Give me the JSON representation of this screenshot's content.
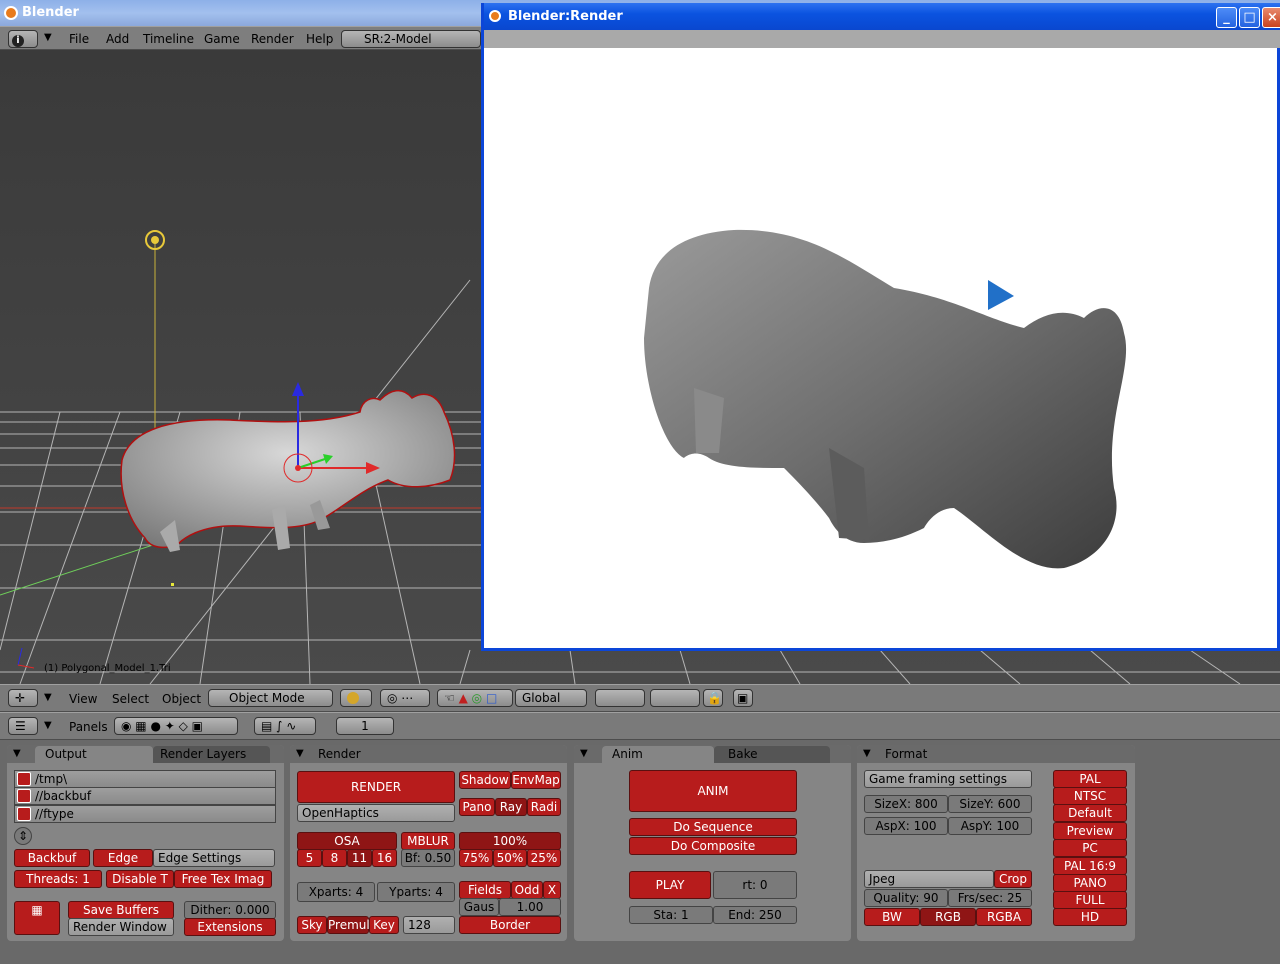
{
  "app": {
    "title": "Blender"
  },
  "menubar": {
    "items": [
      "File",
      "Add",
      "Timeline",
      "Game",
      "Render",
      "Help"
    ],
    "screen": "SR:2-Model"
  },
  "viewport": {
    "object_label": "(1) Polygonal_Model_1.Tri"
  },
  "render_window": {
    "title": "Blender:Render"
  },
  "view3d_header": {
    "menus": [
      "View",
      "Select",
      "Object"
    ],
    "mode": "Object Mode",
    "orientation": "Global"
  },
  "buttons_header": {
    "panels_label": "Panels",
    "frame": "1"
  },
  "output_panel": {
    "tabs": [
      "Output",
      "Render Layers"
    ],
    "paths": [
      "/tmp\\",
      "//backbuf",
      "//ftype"
    ],
    "backbuf": "Backbuf",
    "edge": "Edge",
    "edge_settings": "Edge Settings",
    "threads": "Threads: 1",
    "disable_tex": "Disable T",
    "free_tex": "Free Tex Imag",
    "save_buffers": "Save Buffers",
    "dither": "Dither: 0.000",
    "render_window": "Render Window",
    "extensions": "Extensions"
  },
  "render_panel": {
    "title": "Render",
    "render_btn": "RENDER",
    "renderer": "OpenHaptics",
    "shadow": "Shadow",
    "envmap": "EnvMap",
    "pano": "Pano",
    "ray": "Ray",
    "radi": "Radi",
    "osa": "OSA",
    "osa_values": [
      "5",
      "8",
      "11",
      "16"
    ],
    "mblur": "MBLUR",
    "bf": "Bf: 0.50",
    "percent": "100%",
    "percents": [
      "75%",
      "50%",
      "25%"
    ],
    "xparts": "Xparts: 4",
    "yparts": "Yparts: 4",
    "fields": "Fields",
    "odd": "Odd",
    "x": "X",
    "gaus": "Gaus",
    "gaus_val": "1.00",
    "sky": "Sky",
    "premul": "Premul",
    "key": "Key",
    "bits": "128",
    "border": "Border"
  },
  "anim_panel": {
    "tabs": [
      "Anim",
      "Bake"
    ],
    "anim": "ANIM",
    "do_sequence": "Do Sequence",
    "do_composite": "Do Composite",
    "play": "PLAY",
    "rt": "rt: 0",
    "sta": "Sta: 1",
    "end": "End: 250"
  },
  "format_panel": {
    "title": "Format",
    "preset": "Game framing settings",
    "sizex": "SizeX: 800",
    "sizey": "SizeY: 600",
    "aspx": "AspX: 100",
    "aspy": "AspY: 100",
    "format": "Jpeg",
    "crop": "Crop",
    "quality": "Quality: 90",
    "fps": "Frs/sec: 25",
    "bw": "BW",
    "rgb": "RGB",
    "rgba": "RGBA",
    "presets": [
      "PAL",
      "NTSC",
      "Default",
      "Preview",
      "PC",
      "PAL 16:9",
      "PANO",
      "FULL",
      "HD"
    ]
  }
}
